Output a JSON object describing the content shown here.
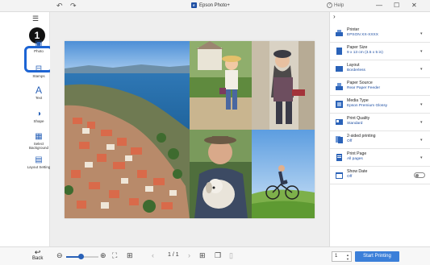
{
  "window": {
    "title": "Epson Photo+",
    "logo_text": "E",
    "help_label": "Help",
    "undo_icon": "undo-icon",
    "redo_icon": "redo-icon"
  },
  "left_toolbar": {
    "step_badge": "1",
    "tools": [
      {
        "label": "Photo",
        "icon": "photo-add-icon"
      },
      {
        "label": "Stamps",
        "icon": "stamp-icon"
      },
      {
        "label": "Text",
        "icon": "text-icon"
      },
      {
        "label": "Shape",
        "icon": "shape-icon"
      },
      {
        "label": "Select Background",
        "icon": "background-icon"
      },
      {
        "label": "Layout Setting",
        "icon": "layout-icon"
      }
    ]
  },
  "settings": [
    {
      "label": "Printer",
      "value": "EPSON XX-XXXX"
    },
    {
      "label": "Paper Size",
      "value": "9 x 13 cm (3.5 x 5 in)"
    },
    {
      "label": "Layout",
      "value": "Borderless"
    },
    {
      "label": "Paper Source",
      "value": "Rear Paper Feeder"
    },
    {
      "label": "Media Type",
      "value": "Epson Premium Glossy"
    },
    {
      "label": "Print Quality",
      "value": "Standard"
    },
    {
      "label": "2-sided printing",
      "value": "Off"
    },
    {
      "label": "Print Page",
      "value": "All pages"
    },
    {
      "label": "Show Date",
      "value": "Off"
    }
  ],
  "bottom_bar": {
    "back_label": "Back",
    "zoom_level": 0.45,
    "page_indicator": "1 / 1",
    "copies": "1",
    "start_label": "Start Printing"
  },
  "colors": {
    "accent": "#1c64d4",
    "link": "#1e4fa3",
    "start_button": "#3b7fd9"
  }
}
